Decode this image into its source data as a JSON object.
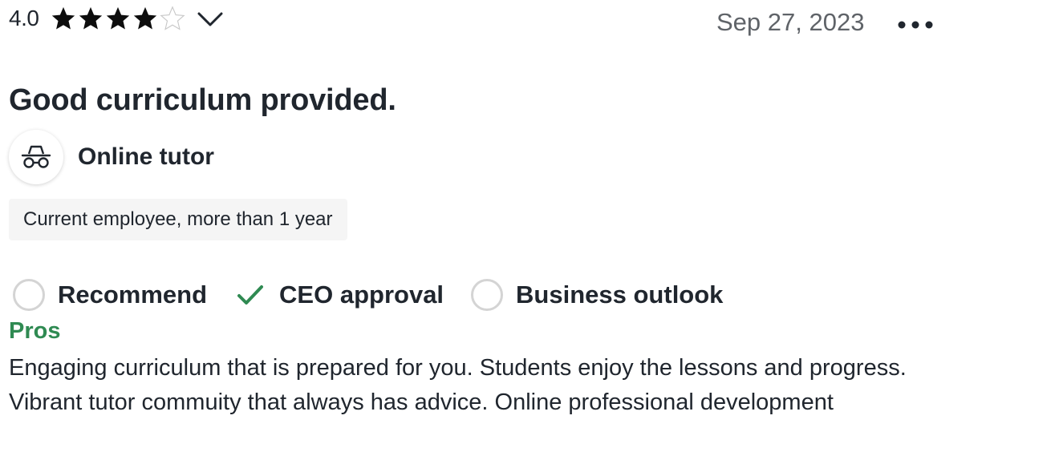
{
  "review": {
    "rating": "4.0",
    "stars_filled": 4,
    "stars_total": 5,
    "date": "Sep 27, 2023",
    "title": "Good curriculum provided.",
    "job_title": "Online tutor",
    "employment": "Current employee, more than 1 year",
    "sub_ratings": [
      {
        "label": "Recommend",
        "state": "neutral"
      },
      {
        "label": "CEO approval",
        "state": "positive"
      },
      {
        "label": "Business outlook",
        "state": "neutral"
      }
    ],
    "pros_label": "Pros",
    "pros_text": "Engaging curriculum that is prepared for you. Students enjoy the lessons and progress. Vibrant tutor commuity that always has advice. Online professional development"
  },
  "icons": {
    "star_filled": "star-filled-icon",
    "star_empty": "star-empty-icon",
    "expand": "chevron-down-icon",
    "more": "more-horizontal-icon",
    "avatar": "incognito-icon",
    "check": "check-icon"
  },
  "colors": {
    "text": "#20262e",
    "muted": "#5f6368",
    "positive": "#2f8a52",
    "neutral_ring": "#d4d4d4"
  }
}
